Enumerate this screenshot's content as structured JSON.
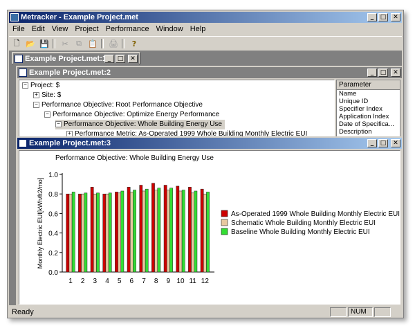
{
  "app": {
    "title": "Metracker - Example Project.met",
    "menu": [
      "File",
      "Edit",
      "View",
      "Project",
      "Performance",
      "Window",
      "Help"
    ],
    "controls": {
      "minimize": "_",
      "maximize": "□",
      "close": "✕"
    }
  },
  "toolbar": {
    "icons": [
      "new-document-icon",
      "open-folder-icon",
      "save-disk-icon",
      "cut-scissors-icon",
      "copy-icon",
      "paste-icon",
      "print-icon",
      "help-icon"
    ],
    "glyphs": [
      "🗋",
      "📂",
      "💾",
      "✂",
      "⧉",
      "📋",
      "🖨",
      "?"
    ]
  },
  "windows": {
    "minimized_title": "Example Project.met:1",
    "tree_title": "Example Project.met:2",
    "chart_title": "Example Project.met:3"
  },
  "tree": {
    "nodes": [
      {
        "label": "Project: $",
        "toggle": "−"
      },
      {
        "label": "Site: $",
        "toggle": "+"
      },
      {
        "label": "Performance Objective: Root Performance Objective",
        "toggle": "−"
      },
      {
        "label": "Performance Objective: Optimize Energy Performance",
        "toggle": "−"
      },
      {
        "label": "Performance Objective: Whole Building Energy Use",
        "toggle": "−"
      },
      {
        "label": "Performance Metric: As-Operated 1999 Whole Building Monthly Electric EUI",
        "toggle": "+"
      }
    ]
  },
  "params": {
    "header": "Parameter",
    "rows": [
      "Name",
      "Unique ID",
      "Specifier Index",
      "Application Index",
      "Date of Specifica...",
      "Description"
    ]
  },
  "chart_data": {
    "type": "bar",
    "title": "Performance Objective: Whole Building Energy Use",
    "ylabel": "Monthly Electric EUI[kWh/ft2/mo]",
    "xlabel": "",
    "categories": [
      "1",
      "2",
      "3",
      "4",
      "5",
      "6",
      "7",
      "8",
      "9",
      "10",
      "11",
      "12"
    ],
    "ylim": [
      0,
      1.0
    ],
    "yticks": [
      "0.0",
      "0.2",
      "0.4",
      "0.6",
      "0.8",
      "1.0"
    ],
    "grid": false,
    "legend_position": "right",
    "series": [
      {
        "name": "As-Operated 1999 Whole Building Monthly Electric EUI",
        "color": "#cc0000",
        "values": [
          0.8,
          0.8,
          0.87,
          0.8,
          0.82,
          0.87,
          0.89,
          0.91,
          0.89,
          0.88,
          0.87,
          0.85
        ]
      },
      {
        "name": "Schematic Whole Building Monthly Electric EUI",
        "color": "#e8c8a0",
        "values": [
          0.8,
          0.8,
          0.8,
          0.8,
          0.81,
          0.82,
          0.83,
          0.84,
          0.84,
          0.83,
          0.81,
          0.8
        ]
      },
      {
        "name": "Baseline Whole Building Monthly Electric EUI",
        "color": "#33dd33",
        "values": [
          0.82,
          0.81,
          0.81,
          0.81,
          0.83,
          0.84,
          0.85,
          0.86,
          0.86,
          0.84,
          0.83,
          0.82
        ]
      }
    ]
  },
  "status": {
    "text": "Ready",
    "panels": [
      "",
      "NUM",
      ""
    ]
  }
}
